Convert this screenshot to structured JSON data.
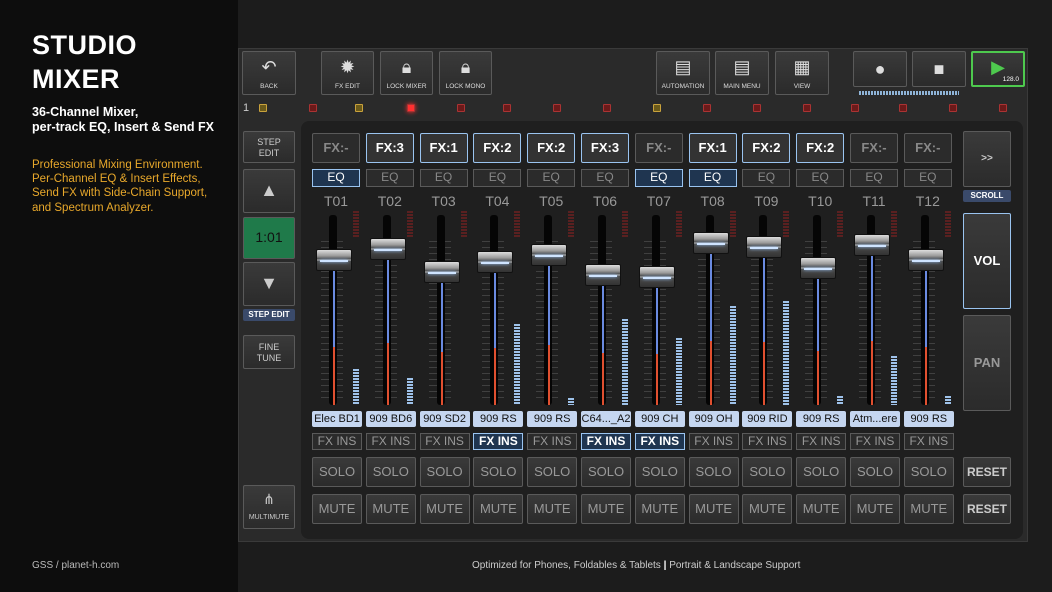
{
  "promo": {
    "title": "STUDIO MIXER",
    "subtitle": "36-Channel Mixer,\nper-track EQ, Insert & Send FX",
    "description": "Professional Mixing Environment.\nPer-Channel EQ & Insert Effects,\nSend FX with Side-Chain Support,\nand Spectrum Analyzer.",
    "credit": "GSS / planet-h.com",
    "footer_left": "Optimized for Phones, Foldables & Tablets",
    "footer_sep": "|",
    "footer_right": "Portrait & Landscape Support"
  },
  "toolbar": {
    "back": "BACK",
    "fx_edit": "FX EDIT",
    "lock_mixer": "LOCK MIXER",
    "lock_mono": "LOCK MONO",
    "automation": "AUTOMATION",
    "main_menu": "MAIN MENU",
    "view": "VIEW",
    "tempo": "128.0"
  },
  "status": {
    "page_number": "1"
  },
  "side": {
    "step_edit_top": "STEP\nEDIT",
    "position": "1:01",
    "step_edit_label": "STEP EDIT",
    "fine_tune": "FINE\nTUNE",
    "multimute": "MULTIMUTE"
  },
  "right": {
    "scroll_btn": ">>",
    "scroll_label": "SCROLL",
    "vol": "VOL",
    "pan": "PAN",
    "reset1": "RESET",
    "reset2": "RESET"
  },
  "channels": [
    {
      "fx": "FX:-",
      "fx_on": false,
      "eq": "EQ",
      "eq_on": true,
      "track": "T01",
      "name": "Elec BD1",
      "ins": "FX INS",
      "ins_on": false,
      "solo": "SOLO",
      "mute": "MUTE",
      "level": 0.82,
      "meter": 0.2
    },
    {
      "fx": "FX:3",
      "fx_on": true,
      "eq": "EQ",
      "eq_on": false,
      "track": "T02",
      "name": "909 BD6",
      "ins": "FX INS",
      "ins_on": false,
      "solo": "SOLO",
      "mute": "MUTE",
      "level": 0.88,
      "meter": 0.15
    },
    {
      "fx": "FX:1",
      "fx_on": true,
      "eq": "EQ",
      "eq_on": false,
      "track": "T03",
      "name": "909 SD2",
      "ins": "FX INS",
      "ins_on": false,
      "solo": "SOLO",
      "mute": "MUTE",
      "level": 0.76,
      "meter": 0.0
    },
    {
      "fx": "FX:2",
      "fx_on": true,
      "eq": "EQ",
      "eq_on": false,
      "track": "T04",
      "name": "909 RS",
      "ins": "FX INS",
      "ins_on": true,
      "solo": "SOLO",
      "mute": "MUTE",
      "level": 0.81,
      "meter": 0.45
    },
    {
      "fx": "FX:2",
      "fx_on": true,
      "eq": "EQ",
      "eq_on": false,
      "track": "T05",
      "name": "909 RS",
      "ins": "FX INS",
      "ins_on": false,
      "solo": "SOLO",
      "mute": "MUTE",
      "level": 0.85,
      "meter": 0.04
    },
    {
      "fx": "FX:3",
      "fx_on": true,
      "eq": "EQ",
      "eq_on": false,
      "track": "T06",
      "name": "C64..._A2",
      "ins": "FX INS",
      "ins_on": true,
      "solo": "SOLO",
      "mute": "MUTE",
      "level": 0.74,
      "meter": 0.48
    },
    {
      "fx": "FX:-",
      "fx_on": false,
      "eq": "EQ",
      "eq_on": true,
      "track": "T07",
      "name": "909 CH",
      "ins": "FX INS",
      "ins_on": true,
      "solo": "SOLO",
      "mute": "MUTE",
      "level": 0.73,
      "meter": 0.37
    },
    {
      "fx": "FX:1",
      "fx_on": true,
      "eq": "EQ",
      "eq_on": true,
      "track": "T08",
      "name": "909 OH",
      "ins": "FX INS",
      "ins_on": false,
      "solo": "SOLO",
      "mute": "MUTE",
      "level": 0.91,
      "meter": 0.55
    },
    {
      "fx": "FX:2",
      "fx_on": true,
      "eq": "EQ",
      "eq_on": false,
      "track": "T09",
      "name": "909 RID",
      "ins": "FX INS",
      "ins_on": false,
      "solo": "SOLO",
      "mute": "MUTE",
      "level": 0.89,
      "meter": 0.58
    },
    {
      "fx": "FX:2",
      "fx_on": true,
      "eq": "EQ",
      "eq_on": false,
      "track": "T10",
      "name": "909 RS",
      "ins": "FX INS",
      "ins_on": false,
      "solo": "SOLO",
      "mute": "MUTE",
      "level": 0.78,
      "meter": 0.05
    },
    {
      "fx": "FX:-",
      "fx_on": false,
      "eq": "EQ",
      "eq_on": false,
      "track": "T11",
      "name": "Atm...ere",
      "ins": "FX INS",
      "ins_on": false,
      "solo": "SOLO",
      "mute": "MUTE",
      "level": 0.9,
      "meter": 0.27
    },
    {
      "fx": "FX:-",
      "fx_on": false,
      "eq": "EQ",
      "eq_on": false,
      "track": "T12",
      "name": "909 RS",
      "ins": "FX INS",
      "ins_on": false,
      "solo": "SOLO",
      "mute": "MUTE",
      "level": 0.82,
      "meter": 0.05
    }
  ],
  "colors": {
    "accent": "#9ac4f0",
    "play_border": "#4ec94e",
    "promo_orange": "#e8a82b",
    "meter_blue": "#9ec2ea"
  }
}
